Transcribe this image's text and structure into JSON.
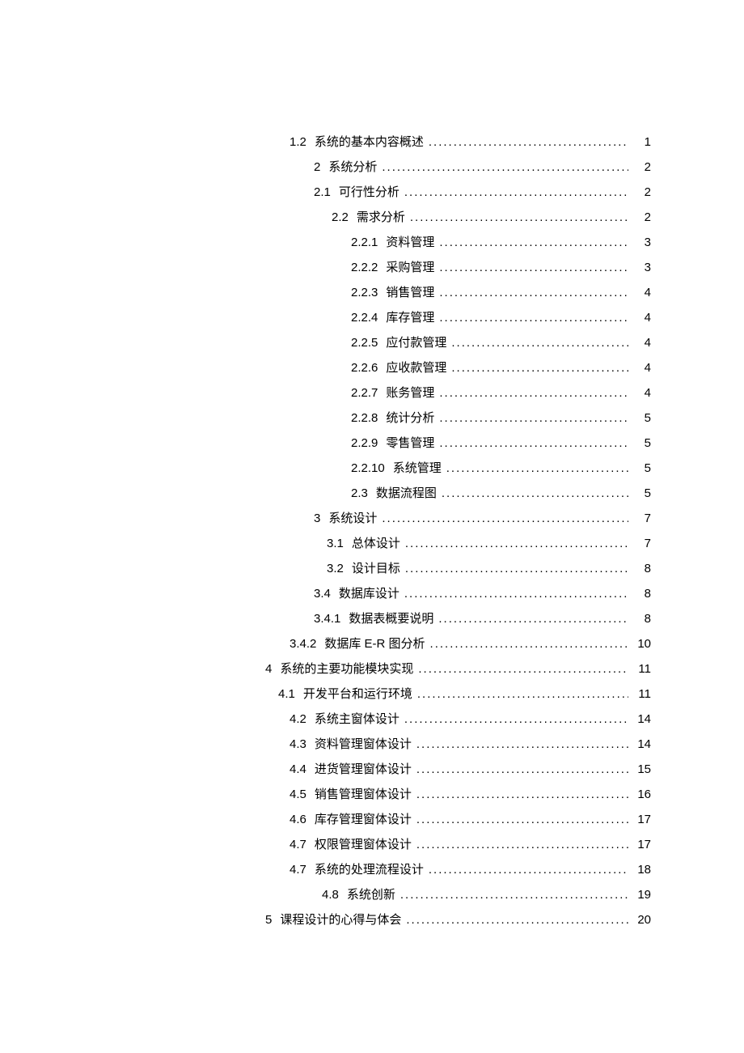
{
  "entries": [
    {
      "indent": 358,
      "num": "1.2",
      "title": "系统的基本内容概述",
      "page": "1"
    },
    {
      "indent": 388,
      "num": "2",
      "title": "系统分析",
      "page": "2"
    },
    {
      "indent": 388,
      "num": "2.1",
      "title": "可行性分析",
      "page": "2"
    },
    {
      "indent": 410,
      "num": "2.2",
      "title": "需求分析",
      "page": "2"
    },
    {
      "indent": 434,
      "num": "2.2.1",
      "title": "资料管理",
      "page": "3"
    },
    {
      "indent": 434,
      "num": "2.2.2",
      "title": "采购管理",
      "page": "3"
    },
    {
      "indent": 434,
      "num": "2.2.3",
      "title": "销售管理",
      "page": "4"
    },
    {
      "indent": 434,
      "num": "2.2.4",
      "title": "库存管理",
      "page": "4"
    },
    {
      "indent": 434,
      "num": "2.2.5",
      "title": "应付款管理",
      "page": "4"
    },
    {
      "indent": 434,
      "num": "2.2.6",
      "title": "应收款管理",
      "page": "4"
    },
    {
      "indent": 434,
      "num": "2.2.7",
      "title": "账务管理",
      "page": "4"
    },
    {
      "indent": 434,
      "num": "2.2.8",
      "title": "统计分析",
      "page": "5"
    },
    {
      "indent": 434,
      "num": "2.2.9",
      "title": "零售管理",
      "page": "5"
    },
    {
      "indent": 434,
      "num": "2.2.10",
      "title": "系统管理",
      "page": "5"
    },
    {
      "indent": 434,
      "num": "2.3",
      "title": "数据流程图",
      "page": "5"
    },
    {
      "indent": 388,
      "num": "3",
      "title": "系统设计",
      "page": "7"
    },
    {
      "indent": 404,
      "num": "3.1",
      "title": "总体设计",
      "page": "7"
    },
    {
      "indent": 404,
      "num": "3.2",
      "title": "设计目标",
      "page": "8"
    },
    {
      "indent": 388,
      "num": "3.4",
      "title": "数据库设计",
      "page": "8"
    },
    {
      "indent": 388,
      "num": "3.4.1",
      "title": "数据表概要说明",
      "page": "8"
    },
    {
      "indent": 358,
      "num": "3.4.2",
      "title": "数据库 E-R 图分析",
      "page": "10"
    },
    {
      "indent": 328,
      "num": "4",
      "title": "系统的主要功能模块实现",
      "page": "11"
    },
    {
      "indent": 344,
      "num": "4.1",
      "title": "开发平台和运行环境",
      "page": "11"
    },
    {
      "indent": 358,
      "num": "4.2",
      "title": "系统主窗体设计",
      "page": "14"
    },
    {
      "indent": 358,
      "num": "4.3",
      "title": "资料管理窗体设计",
      "page": "14"
    },
    {
      "indent": 358,
      "num": "4.4",
      "title": "进货管理窗体设计",
      "page": "15"
    },
    {
      "indent": 358,
      "num": "4.5",
      "title": "销售管理窗体设计",
      "page": "16"
    },
    {
      "indent": 358,
      "num": "4.6",
      "title": "库存管理窗体设计",
      "page": "17"
    },
    {
      "indent": 358,
      "num": "4.7",
      "title": "权限管理窗体设计",
      "page": "17"
    },
    {
      "indent": 358,
      "num": "4.7",
      "title": "系统的处理流程设计",
      "page": "18"
    },
    {
      "indent": 398,
      "num": "4.8",
      "title": "系统创新",
      "page": "19"
    },
    {
      "indent": 328,
      "num": "5",
      "title": "课程设计的心得与体会",
      "page": "20"
    }
  ],
  "dots": "..........................................................................................................."
}
